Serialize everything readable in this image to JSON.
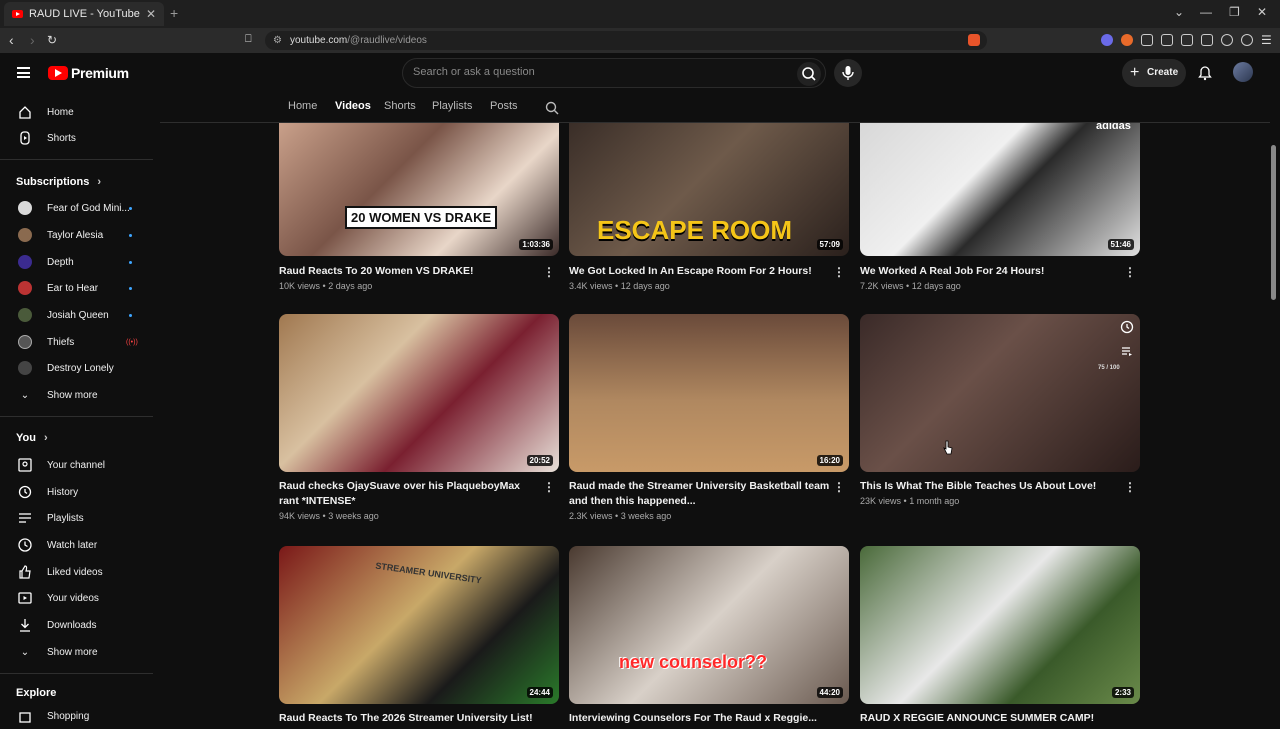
{
  "browser": {
    "tab_title": "RAUD LIVE - YouTube",
    "tab_close": "✕",
    "new_tab": "+",
    "url_host": "youtube.com",
    "url_path": "/@raudlive/videos"
  },
  "masthead": {
    "brand": "Premium",
    "search_placeholder": "Search or ask a question",
    "create_label": "Create"
  },
  "sidebar": {
    "main": [
      {
        "label": "Home",
        "icon": "home-icon"
      },
      {
        "label": "Shorts",
        "icon": "shorts-icon"
      }
    ],
    "subscriptions_heading": "Subscriptions",
    "subscriptions": [
      {
        "label": "Fear of God Mini...",
        "color": "#d9d9d9",
        "status": "dot"
      },
      {
        "label": "Taylor Alesia",
        "color": "#8a6a4f",
        "status": "dot"
      },
      {
        "label": "Depth",
        "color": "#3b2b8f",
        "status": "dot"
      },
      {
        "label": "Ear to Hear",
        "color": "#b33",
        "status": "dot"
      },
      {
        "label": "Josiah Queen",
        "color": "#4a5a3a",
        "status": "dot"
      },
      {
        "label": "Thiefs",
        "color": "#555",
        "status": "live"
      },
      {
        "label": "Destroy Lonely",
        "color": "#444",
        "status": ""
      }
    ],
    "subs_show_more": "Show more",
    "you_heading": "You",
    "you_items": [
      {
        "label": "Your channel",
        "icon": "channel-icon"
      },
      {
        "label": "History",
        "icon": "history-icon"
      },
      {
        "label": "Playlists",
        "icon": "playlists-icon"
      },
      {
        "label": "Watch later",
        "icon": "watch-later-icon"
      },
      {
        "label": "Liked videos",
        "icon": "like-icon"
      },
      {
        "label": "Your videos",
        "icon": "your-videos-icon"
      },
      {
        "label": "Downloads",
        "icon": "download-icon"
      }
    ],
    "you_show_more": "Show more",
    "explore_heading": "Explore",
    "explore_items": [
      {
        "label": "Shopping",
        "icon": "shopping-icon"
      }
    ]
  },
  "channel_tabs": [
    "Home",
    "Videos",
    "Shorts",
    "Playlists",
    "Posts"
  ],
  "active_tab": "Videos",
  "videos": [
    {
      "title": "Raud Reacts To 20 Women VS DRAKE!",
      "views": "10K views",
      "age": "2 days ago",
      "duration": "1:03:36",
      "overlay": "20 WOMEN VS DRAKE",
      "bg": "linear-gradient(135deg,#c9a08a,#7a5548 40%,#e8d6c8 70%,#3a2a28)"
    },
    {
      "title": "We Got Locked In An Escape Room For 2 Hours!",
      "views": "3.4K views",
      "age": "12 days ago",
      "duration": "57:09",
      "overlay": "ESCAPE ROOM",
      "bg": "linear-gradient(135deg,#3a2e28,#6e5a4a 45%,#2a201c)"
    },
    {
      "title": "We Worked A Real Job For 24 Hours!",
      "views": "7.2K views",
      "age": "12 days ago",
      "duration": "51:46",
      "overlay": "adidas",
      "bg": "linear-gradient(135deg,#d8d8d8,#f0f0f0 40%,#2a2a2a 55%,#e0e0e0)"
    },
    {
      "title": "Raud checks OjaySuave over his PlaqueboyMax rant *INTENSE*",
      "views": "94K views",
      "age": "3 weeks ago",
      "duration": "20:52",
      "overlay": "",
      "bg": "linear-gradient(135deg,#a07850,#d8c0a0 35%,#7a2030 60%,#e8e0d8)"
    },
    {
      "title": "Raud made the Streamer University Basketball team and then this happened...",
      "views": "2.3K views",
      "age": "3 weeks ago",
      "duration": "16:20",
      "overlay": "",
      "bg": "linear-gradient(180deg,#6a4a3a,#b08860 55%,#c89a68)"
    },
    {
      "title": "This Is What The Bible Teaches Us About Love!",
      "views": "23K views",
      "age": "1 month ago",
      "duration": "",
      "overlay": "75 / 100",
      "bg": "linear-gradient(135deg,#3a2a28,#6a5048 40%,#2a1c1a)"
    },
    {
      "title": "Raud Reacts To The 2026 Streamer University List!",
      "views": "",
      "age": "",
      "duration": "24:44",
      "overlay": "STREAMER UNIVERSITY",
      "bg": "linear-gradient(135deg,#7a1818,#c8a868 45%,#1a1a1a 70%,#2a7a2a)"
    },
    {
      "title": "Interviewing Counselors For The Raud x Reggie...",
      "views": "",
      "age": "",
      "duration": "44:20",
      "overlay": "new counselor??",
      "bg": "linear-gradient(135deg,#4a3a30,#d8d0c8 50%,#6a5a50)"
    },
    {
      "title": "RAUD X REGGIE ANNOUNCE SUMMER CAMP!",
      "views": "",
      "age": "",
      "duration": "2:33",
      "overlay": "",
      "bg": "linear-gradient(135deg,#4a6a3a,#e8e8e8 45%,#3a5a2a 70%,#6a8a4a)"
    }
  ]
}
